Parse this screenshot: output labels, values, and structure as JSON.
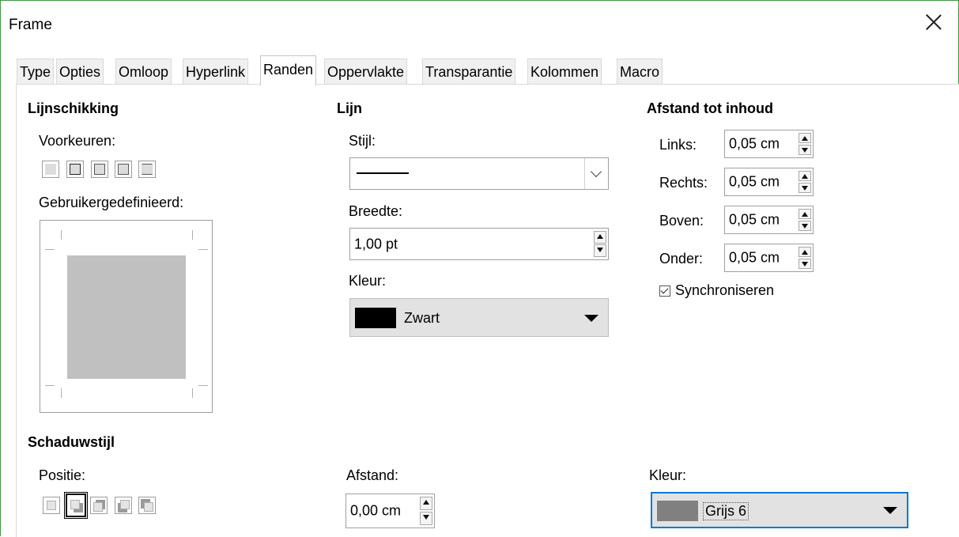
{
  "window": {
    "title": "Frame"
  },
  "tabs": [
    {
      "label": "Type"
    },
    {
      "label": "Opties"
    },
    {
      "label": "Omloop"
    },
    {
      "label": "Hyperlink"
    },
    {
      "label": "Randen",
      "active": true
    },
    {
      "label": "Oppervlakte"
    },
    {
      "label": "Transparantie"
    },
    {
      "label": "Kolommen"
    },
    {
      "label": "Macro"
    }
  ],
  "line_arrangement": {
    "heading": "Lijnschikking",
    "presets_label": "Voorkeuren:",
    "custom_label": "Gebruikergedefinieerd:"
  },
  "line": {
    "heading": "Lijn",
    "style_label": "Stijl:",
    "width_label": "Breedte:",
    "width_value": "1,00 pt",
    "color_label": "Kleur:",
    "color_value": "Zwart",
    "color_hex": "#000000"
  },
  "padding": {
    "heading": "Afstand tot inhoud",
    "left_label": "Links:",
    "left_value": "0,05 cm",
    "right_label": "Rechts:",
    "right_value": "0,05 cm",
    "top_label": "Boven:",
    "top_value": "0,05 cm",
    "bottom_label": "Onder:",
    "bottom_value": "0,05 cm",
    "sync_label": "Synchroniseren",
    "sync_checked": true
  },
  "shadow": {
    "heading": "Schaduwstijl",
    "position_label": "Positie:",
    "distance_label": "Afstand:",
    "distance_value": "0,00 cm",
    "color_label": "Kleur:",
    "color_value": "Grijs 6",
    "color_hex": "#808080"
  },
  "colors": {
    "accent": "#3c9a3c",
    "focus": "#0078d7"
  }
}
